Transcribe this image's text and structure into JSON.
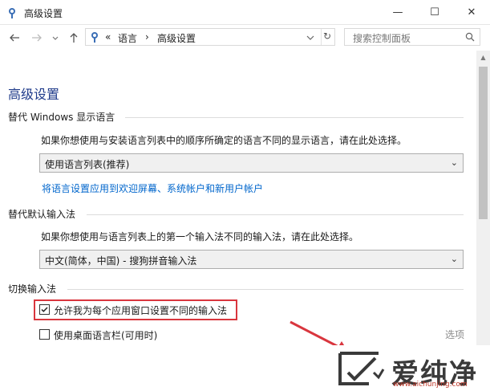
{
  "window": {
    "title": "高级设置",
    "icon": "control-panel-icon",
    "minimize": "—",
    "maximize": "☐",
    "close": "✕"
  },
  "nav": {
    "back": "back-arrow-icon",
    "forward": "forward-arrow-icon",
    "recent": "chevron-down-icon",
    "up": "up-arrow-icon",
    "breadcrumb_prefix": "«",
    "breadcrumb": [
      "语言",
      "高级设置"
    ],
    "breadcrumb_sep": "›",
    "refresh": "↻",
    "search_placeholder": "搜索控制面板"
  },
  "page": {
    "title": "高级设置",
    "sections": {
      "display_language": {
        "title": "替代 Windows 显示语言",
        "description": "如果你想使用与安装语言列表中的顺序所确定的语言不同的显示语言，请在此处选择。",
        "select_value": "使用语言列表(推荐)",
        "link": "将语言设置应用到欢迎屏幕、系统帐户和新用户帐户"
      },
      "input_method": {
        "title": "替代默认输入法",
        "description": "如果你想使用与语言列表上的第一个输入法不同的输入法，请在此处选择。",
        "select_value": "中文(简体，中国) - 搜狗拼音输入法"
      },
      "switch_input": {
        "title": "切换输入法",
        "checkbox1_label": "允许我为每个应用窗口设置不同的输入法",
        "checkbox1_checked": true,
        "checkbox2_label": "使用桌面语言栏(可用时)",
        "checkbox2_checked": false,
        "options_link": "选项"
      }
    }
  },
  "watermark": {
    "text": "爱纯净",
    "url": "www.aichunjing.com"
  },
  "colors": {
    "highlight_box": "#d9363e",
    "link": "#0066cc",
    "page_title": "#1e3a8a",
    "arrow": "#d9363e"
  }
}
